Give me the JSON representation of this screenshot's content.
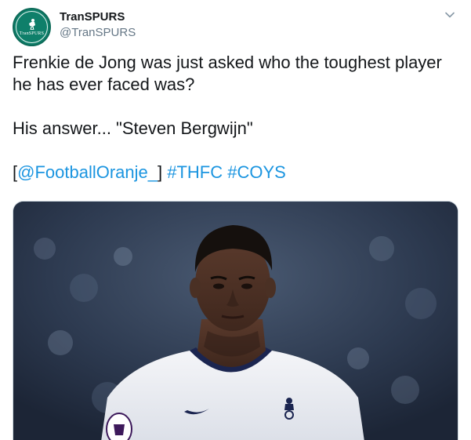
{
  "author": {
    "display_name": "TranSPURS",
    "handle": "@TranSPURS",
    "avatar_text": "TranSPURS",
    "avatar_icon": "cockerel-icon",
    "avatar_color": "#0f7f6a"
  },
  "menu": {
    "icon": "chevron-down-icon"
  },
  "tweet": {
    "line1": "Frenkie de Jong was just asked who the toughest player",
    "line2": "he has ever faced was?",
    "line3": "His answer... \"Steven Bergwijn\"",
    "bracket_open": "[",
    "mention": "@FootballOranje_",
    "bracket_close": "]",
    "hashtag1": "#THFC",
    "hashtag2": "#COYS"
  },
  "colors": {
    "link": "#1b95e0",
    "text": "#14171a",
    "secondary": "#657786"
  },
  "media": {
    "description_icon": "player-photo"
  }
}
